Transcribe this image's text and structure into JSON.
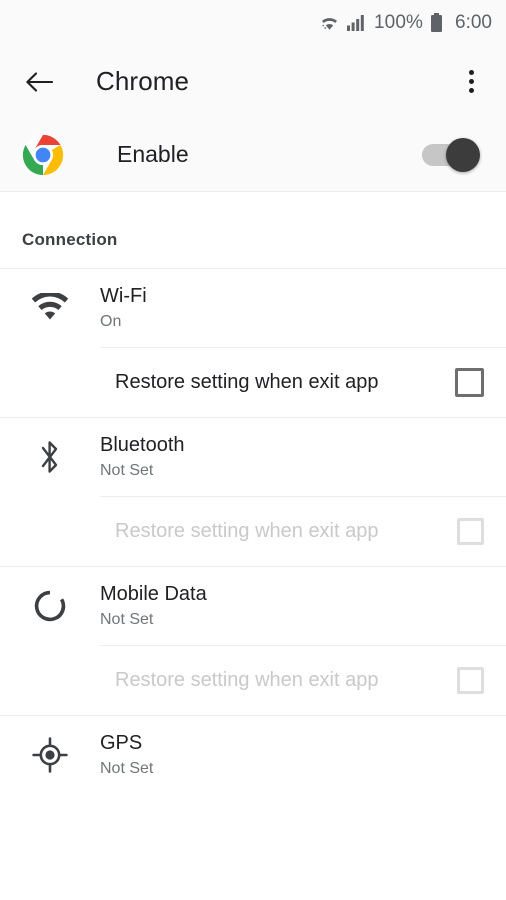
{
  "status_bar": {
    "wifi_icon": "wifi-icon",
    "signal_icon": "cellular-signal-icon",
    "battery_percent": "100%",
    "battery_icon": "battery-full-icon",
    "time": "6:00"
  },
  "app_bar": {
    "back_icon": "back-arrow-icon",
    "title": "Chrome",
    "overflow_icon": "overflow-menu-icon"
  },
  "enable_row": {
    "app_icon": "chrome-logo-icon",
    "label": "Enable",
    "toggle_state": "on"
  },
  "section": {
    "header": "Connection"
  },
  "colors": {
    "accent_thumb": "#3c3c3c",
    "track": "#c6c6c6",
    "title_text": "#202124",
    "subtitle_text": "#70757a",
    "disabled_text": "#c9c9c9",
    "checkbox_enabled": "#6e6e6e",
    "checkbox_disabled": "#dedede",
    "app_bar_bg": "#fafafa",
    "divider": "#ececec",
    "chrome_red": "#ea4335",
    "chrome_green": "#34a853",
    "chrome_yellow": "#fbbc05",
    "chrome_blue": "#4285f4"
  },
  "groups": [
    {
      "icon": "wifi-icon",
      "title": "Wi-Fi",
      "subtitle": "On",
      "restore": {
        "label": "Restore setting when exit app",
        "checked": false,
        "enabled": true
      }
    },
    {
      "icon": "bluetooth-icon",
      "title": "Bluetooth",
      "subtitle": "Not Set",
      "restore": {
        "label": "Restore setting when exit app",
        "checked": false,
        "enabled": false
      }
    },
    {
      "icon": "mobile-data-icon",
      "title": "Mobile Data",
      "subtitle": "Not Set",
      "restore": {
        "label": "Restore setting when exit app",
        "checked": false,
        "enabled": false
      }
    },
    {
      "icon": "gps-icon",
      "title": "GPS",
      "subtitle": "Not Set",
      "restore": null
    }
  ]
}
